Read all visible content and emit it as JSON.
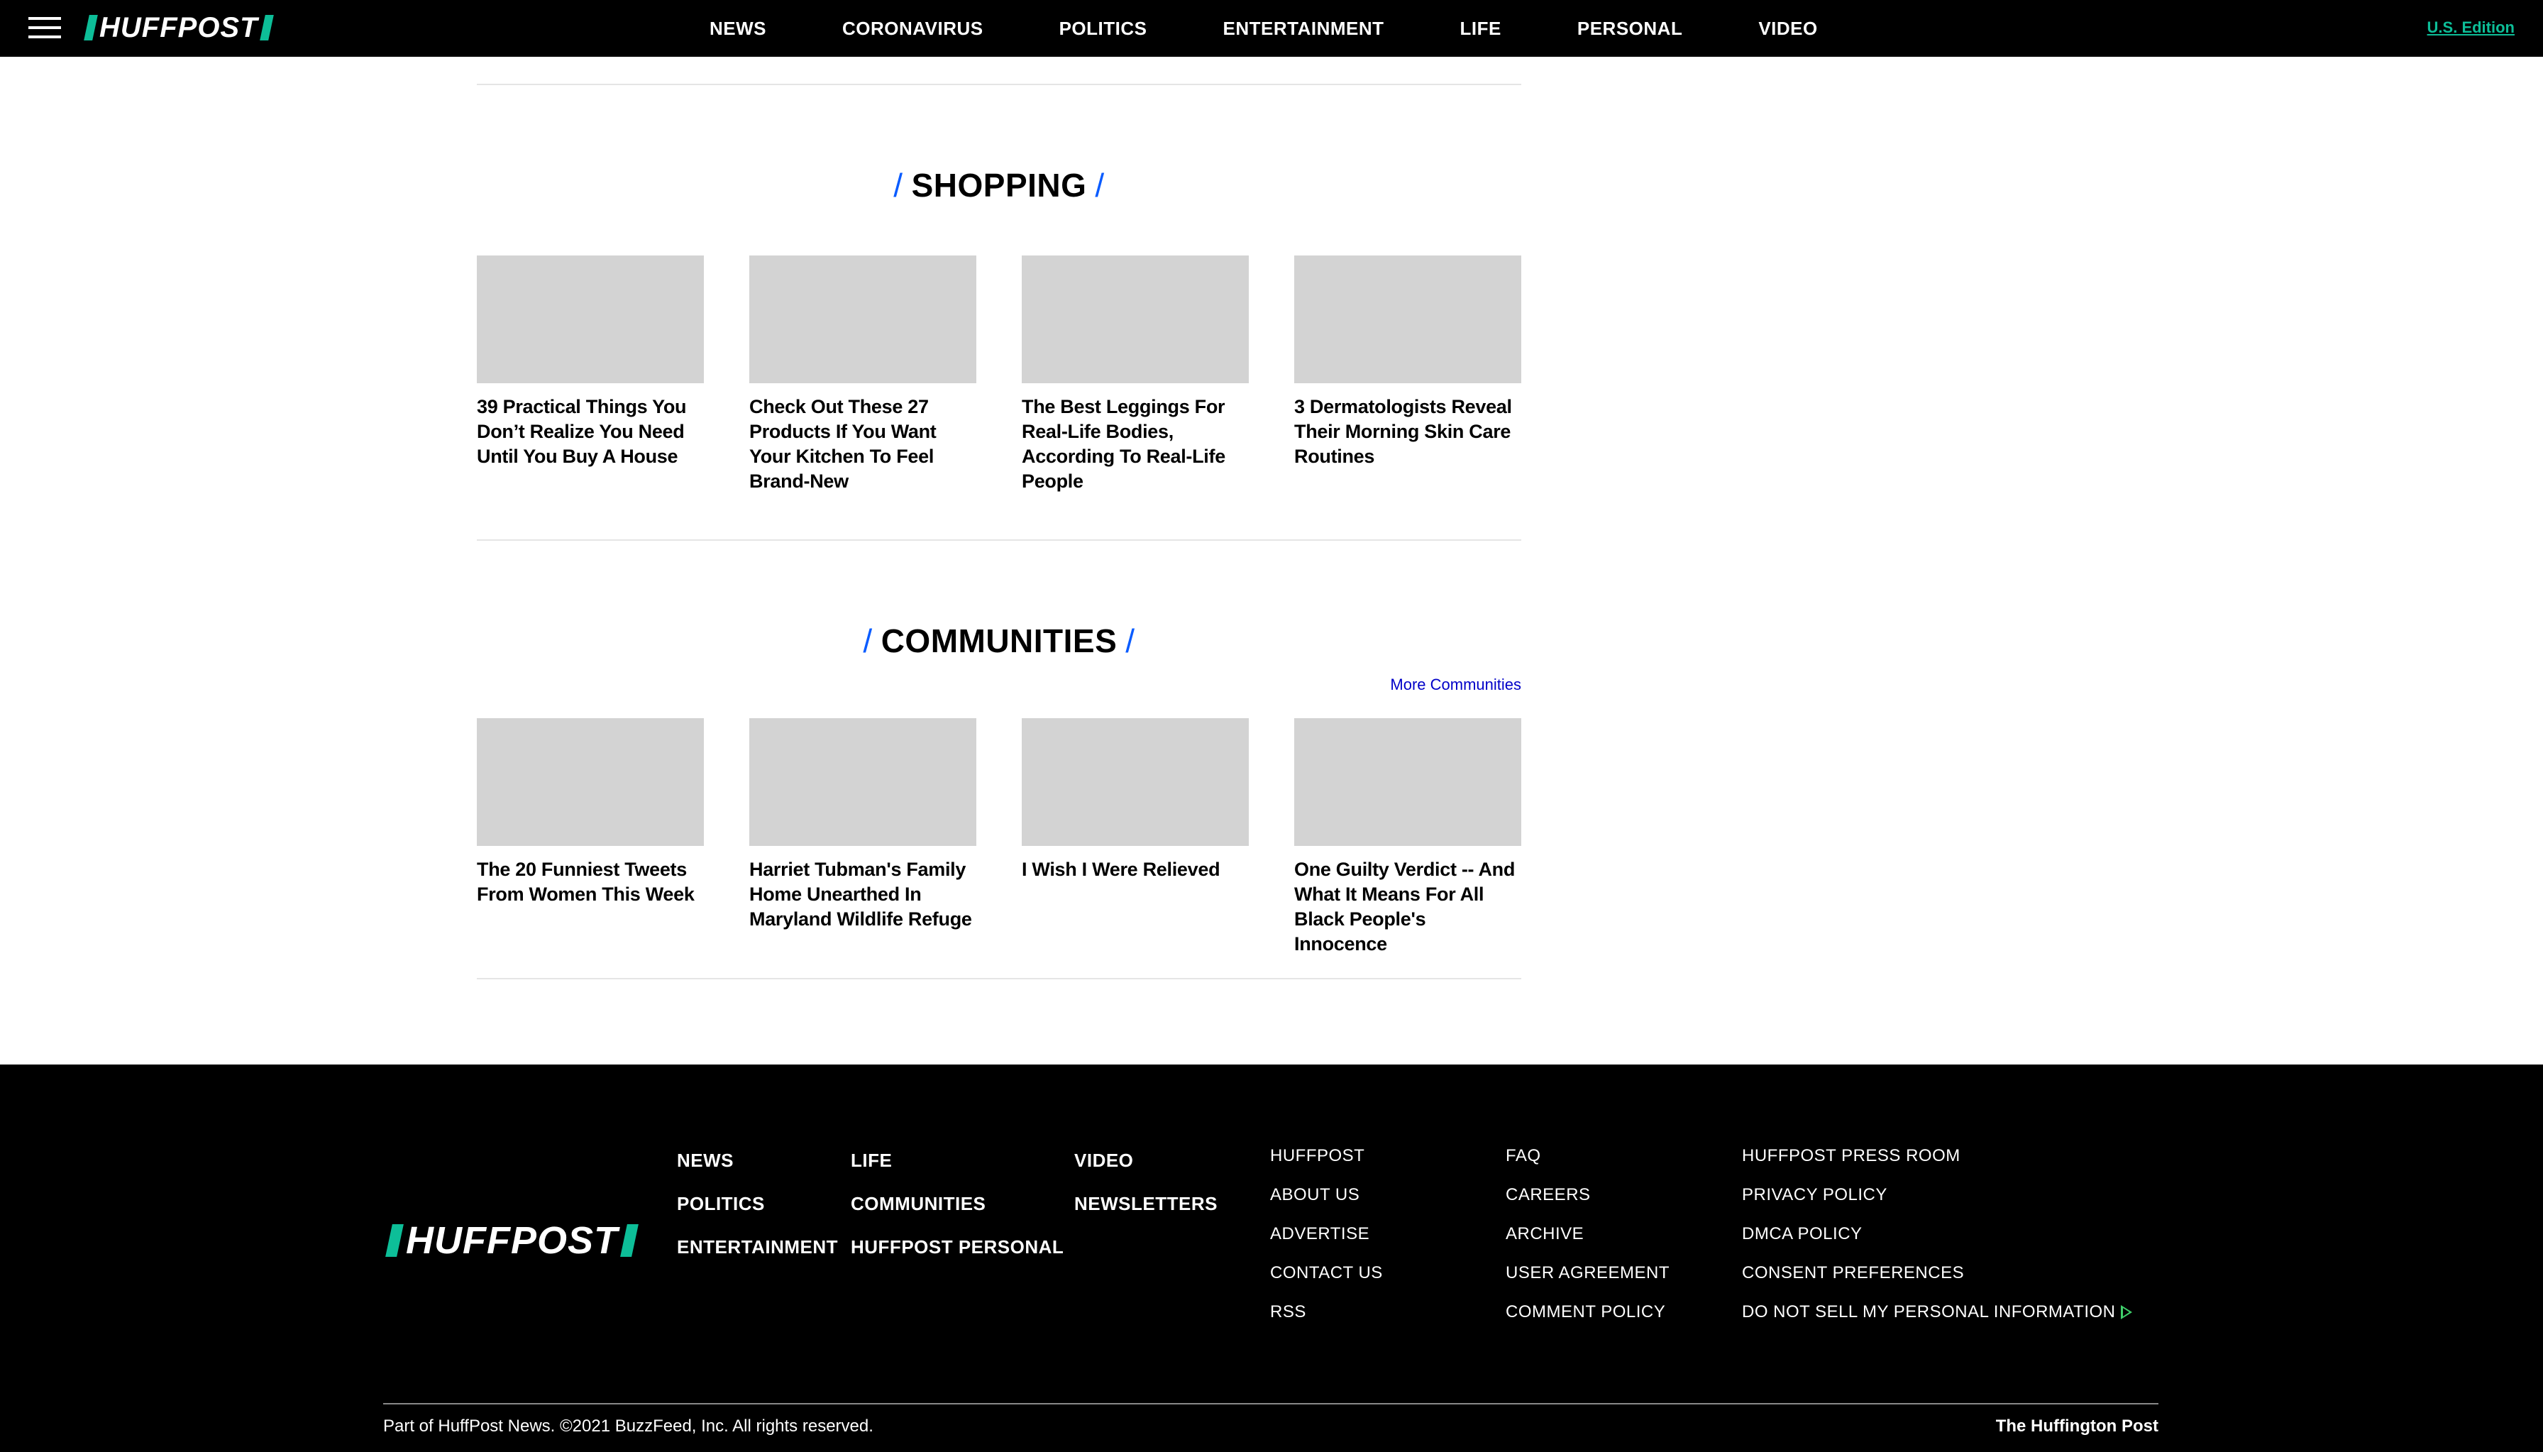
{
  "header": {
    "logo": "HUFFPOST",
    "nav": [
      "NEWS",
      "CORONAVIRUS",
      "POLITICS",
      "ENTERTAINMENT",
      "LIFE",
      "PERSONAL",
      "VIDEO"
    ],
    "edition": "U.S. Edition"
  },
  "shopping": {
    "title": "SHOPPING",
    "items": [
      {
        "title": "39 Practical Things You Don’t Realize You Need Until You Buy A House"
      },
      {
        "title": "Check Out These 27 Products If You Want Your Kitchen To Feel Brand-New"
      },
      {
        "title": "The Best Leggings For Real-Life Bodies, According To Real-Life People"
      },
      {
        "title": "3 Dermatologists Reveal Their Morning Skin Care Routines"
      }
    ]
  },
  "communities": {
    "title": "COMMUNITIES",
    "more_link": "More Communities",
    "items": [
      {
        "title": "The 20 Funniest Tweets From Women This Week"
      },
      {
        "title": "Harriet Tubman's Family Home Unearthed In Maryland Wildlife Refuge"
      },
      {
        "title": "I Wish I Were Relieved"
      },
      {
        "title": "One Guilty Verdict -- And What It Means For All Black People's Innocence"
      }
    ]
  },
  "footer": {
    "logo": "HUFFPOST",
    "col1": [
      "NEWS",
      "POLITICS",
      "ENTERTAINMENT"
    ],
    "col2": [
      "LIFE",
      "COMMUNITIES",
      "HUFFPOST PERSONAL"
    ],
    "col3": [
      "VIDEO",
      "NEWSLETTERS"
    ],
    "col4": [
      "HUFFPOST",
      "ABOUT US",
      "ADVERTISE",
      "CONTACT US",
      "RSS"
    ],
    "col5": [
      "FAQ",
      "CAREERS",
      "ARCHIVE",
      "USER AGREEMENT",
      "COMMENT POLICY"
    ],
    "col6": [
      "HUFFPOST PRESS ROOM",
      "PRIVACY POLICY",
      "DMCA POLICY",
      "CONSENT PREFERENCES",
      "DO NOT SELL MY PERSONAL INFORMATION"
    ],
    "copyright": "Part of HuffPost News. ©2021 BuzzFeed, Inc. All rights reserved.",
    "brand": "The Huffington Post"
  },
  "colors": {
    "accent_green": "#0dbe98",
    "accent_blue": "#0a5cff",
    "link_blue": "#0000c8",
    "thumb_gray": "#d3d3d3"
  }
}
